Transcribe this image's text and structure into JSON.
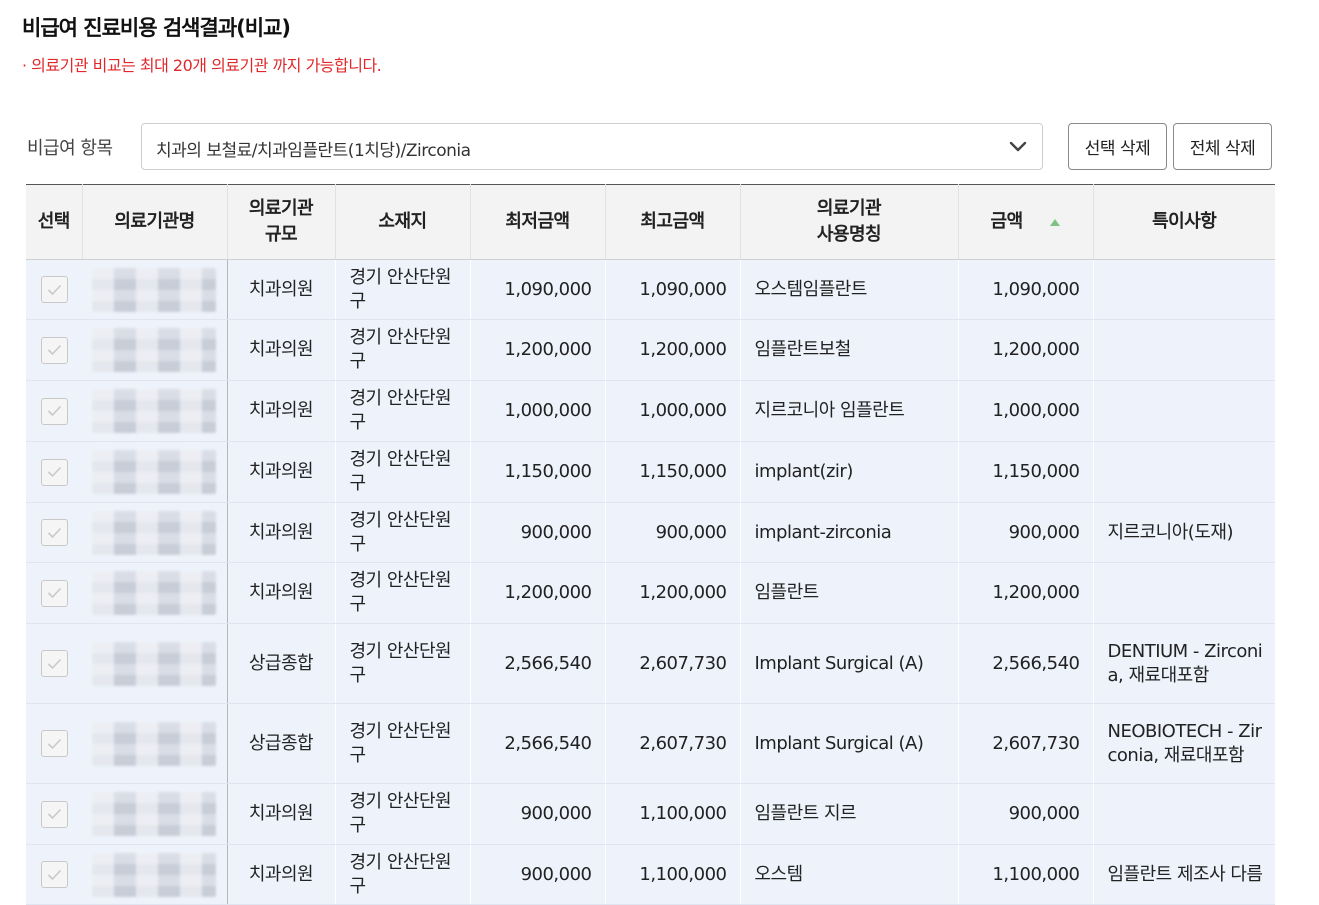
{
  "page": {
    "title": "비급여 진료비용 검색결과(비교)",
    "notice": "· 의료기관 비교는 최대 20개 의료기관 까지 가능합니다."
  },
  "filter": {
    "label": "비급여 항목",
    "selected": "치과의 보철료/치과임플란트(1치당)/Zirconia"
  },
  "buttons": {
    "delete_selected": "선택 삭제",
    "delete_all": "전체 삭제"
  },
  "table": {
    "headers": {
      "select": "선택",
      "name": "의료기관명",
      "scale_1": "의료기관",
      "scale_2": "규모",
      "location": "소재지",
      "min_price": "최저금액",
      "max_price": "최고금액",
      "usage_1": "의료기관",
      "usage_2": "사용명칭",
      "amount": "금액",
      "remarks": "특이사항"
    },
    "sort": {
      "column": "amount",
      "direction": "asc",
      "icon": "sort-up-icon",
      "color": "#5cb85c"
    },
    "rows": [
      {
        "scale": "치과의원",
        "location": "경기 안산단원구",
        "min": "1,090,000",
        "max": "1,090,000",
        "usage": "오스템임플란트",
        "amount": "1,090,000",
        "remarks": ""
      },
      {
        "scale": "치과의원",
        "location": "경기 안산단원구",
        "min": "1,200,000",
        "max": "1,200,000",
        "usage": "임플란트보철",
        "amount": "1,200,000",
        "remarks": ""
      },
      {
        "scale": "치과의원",
        "location": "경기 안산단원구",
        "min": "1,000,000",
        "max": "1,000,000",
        "usage": "지르코니아 임플란트",
        "amount": "1,000,000",
        "remarks": ""
      },
      {
        "scale": "치과의원",
        "location": "경기 안산단원구",
        "min": "1,150,000",
        "max": "1,150,000",
        "usage": "implant(zir)",
        "amount": "1,150,000",
        "remarks": ""
      },
      {
        "scale": "치과의원",
        "location": "경기 안산단원구",
        "min": "900,000",
        "max": "900,000",
        "usage": "implant-zirconia",
        "amount": "900,000",
        "remarks": "지르코니아(도재)"
      },
      {
        "scale": "치과의원",
        "location": "경기 안산단원구",
        "min": "1,200,000",
        "max": "1,200,000",
        "usage": "임플란트",
        "amount": "1,200,000",
        "remarks": ""
      },
      {
        "scale": "상급종합",
        "location": "경기 안산단원구",
        "min": "2,566,540",
        "max": "2,607,730",
        "usage": "Implant Surgical (A)",
        "amount": "2,566,540",
        "remarks": "DENTIUM - Zirconia, 재료대포함"
      },
      {
        "scale": "상급종합",
        "location": "경기 안산단원구",
        "min": "2,566,540",
        "max": "2,607,730",
        "usage": "Implant Surgical (A)",
        "amount": "2,607,730",
        "remarks": "NEOBIOTECH - Zirconia, 재료대포함"
      },
      {
        "scale": "치과의원",
        "location": "경기 안산단원구",
        "min": "900,000",
        "max": "1,100,000",
        "usage": "임플란트 지르",
        "amount": "900,000",
        "remarks": ""
      },
      {
        "scale": "치과의원",
        "location": "경기 안산단원구",
        "min": "900,000",
        "max": "1,100,000",
        "usage": "오스템",
        "amount": "1,100,000",
        "remarks": "임플란트 제조사 다름"
      }
    ]
  },
  "colors": {
    "notice": "#e0282b",
    "row_background": "#eef3fb",
    "header_background": "#f3f3f3"
  }
}
